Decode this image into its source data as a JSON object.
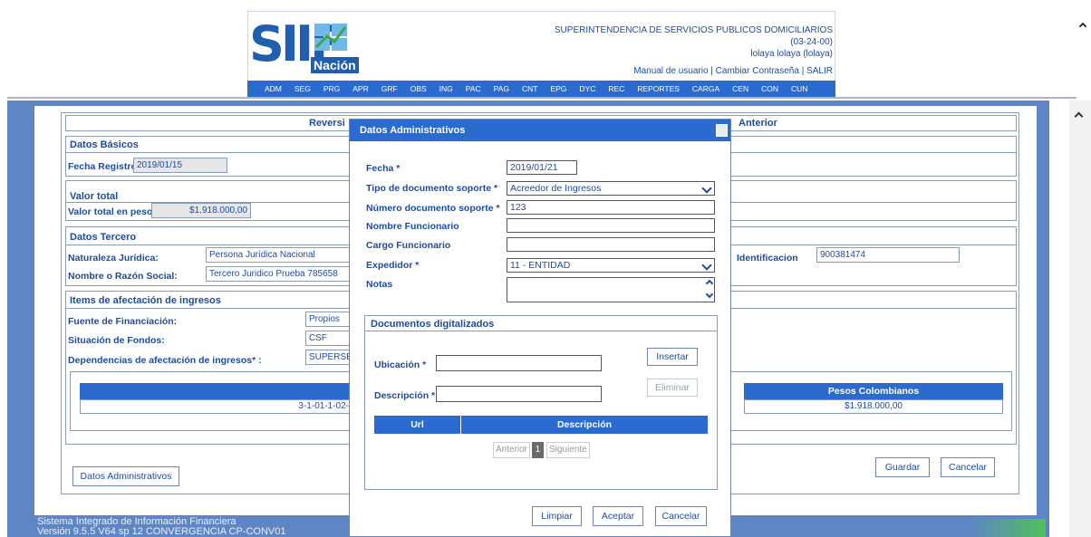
{
  "header": {
    "org_name": "SUPERINTENDENCIA DE SERVICIOS PUBLICOS DOMICILIARIOS",
    "org_code": "(03-24-00)",
    "user": "lolaya lolaya (lolaya)",
    "links": "Manual de usuario | Cambiar Contraseña | SALIR",
    "logo_main": "SIIF",
    "logo_sub": "Nación"
  },
  "menu": [
    "ADM",
    "SEG",
    "PRG",
    "APR",
    "GRF",
    "OBS",
    "ING",
    "PAC",
    "PAG",
    "CNT",
    "EPG",
    "DYC",
    "REC",
    "REPORTES",
    "CARGA",
    "CEN",
    "CON",
    "CUN"
  ],
  "page": {
    "banner_left": "Reversi",
    "banner_right": "Anterior",
    "datos_basicos": {
      "title": "Datos Básicos",
      "fecha_label": "Fecha Registro:",
      "fecha_value": "2019/01/15"
    },
    "valor_total": {
      "title": "Valor total",
      "label": "Valor total en pesos",
      "value": "$1.918.000,00"
    },
    "tercero": {
      "title": "Datos Tercero",
      "naturaleza_label": "Naturaleza Jurídica:",
      "naturaleza_value": "Persona Jurídica Nacional",
      "nombre_label": "Nombre o Razón Social:",
      "nombre_value": "Tercero Juridico Prueba 785658",
      "id_label": "Identificacion",
      "id_value": "900381474"
    },
    "items": {
      "title": "Items de afectación de ingresos",
      "fuente_label": "Fuente de Financiación:",
      "fuente_value": "Propios",
      "situacion_label": "Situación de Fondos:",
      "situacion_value": "CSF",
      "dependencias_label": "Dependencias de afectación de ingresos* :",
      "dependencias_value": "SUPERSE",
      "table_header_right": "Pesos Colombianos",
      "row_code": "3-1-01-1-02-",
      "row_value": "$1.918.000,00"
    },
    "btn_datos_admin": "Datos Administrativos",
    "btn_guardar": "Guardar",
    "btn_cancelar": "Cancelar"
  },
  "footer": {
    "line1": "Sistema Integrado de Información Financiera",
    "line2": "Versión 9.5.5 V64 sp 12 CONVERGENCIA CP-CONV01"
  },
  "modal": {
    "title": "Datos Administrativos",
    "fecha_label": "Fecha *",
    "fecha_value": "2019/01/21",
    "tipo_label": "Tipo de documento soporte *",
    "tipo_value": "Acreedor de Ingresos",
    "numero_label": "Número documento soporte *",
    "numero_value": "123",
    "nombre_label": "Nombre Funcionario",
    "nombre_value": "",
    "cargo_label": "Cargo Funcionario",
    "cargo_value": "",
    "expedidor_label": "Expedidor *",
    "expedidor_value": "11 - ENTIDAD",
    "notas_label": "Notas",
    "notas_value": "",
    "docs": {
      "title": "Documentos digitalizados",
      "ubicacion_label": "Ubicación *",
      "descripcion_label": "Descripción *",
      "btn_insertar": "Insertar",
      "btn_eliminar": "Eliminar",
      "col_url": "Url",
      "col_desc": "Descripción",
      "pager_prev": "Anterior",
      "pager_page": "1",
      "pager_next": "Siguiente"
    },
    "btn_limpiar": "Limpiar",
    "btn_aceptar": "Aceptar",
    "btn_cancelar": "Cancelar"
  }
}
